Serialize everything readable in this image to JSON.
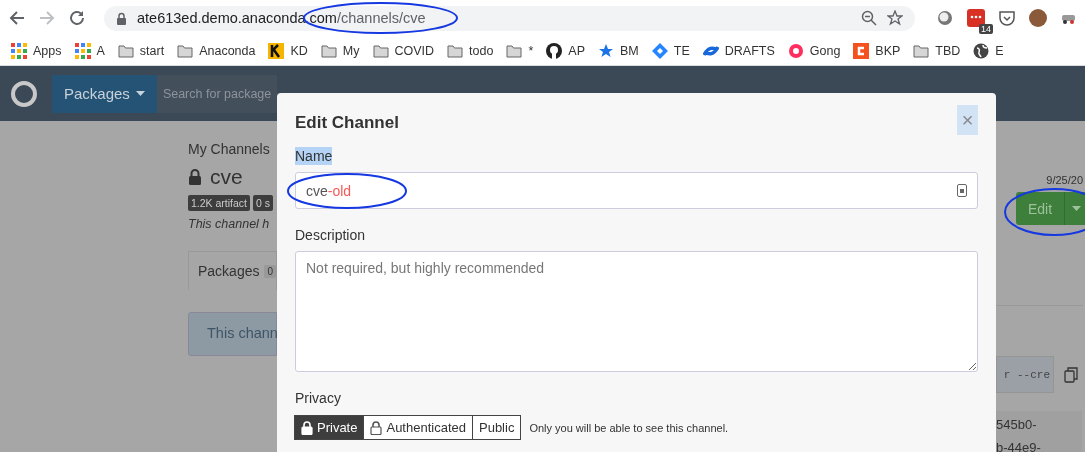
{
  "browser": {
    "forward_disabled": true,
    "url_host": "ate613ed.demo.anaconda.com",
    "url_path": "/channels/cve",
    "extension_badge": "14",
    "bookmarks": [
      {
        "label": "Apps",
        "kind": "apps"
      },
      {
        "label": "A",
        "kind": "apps"
      },
      {
        "label": "start",
        "kind": "folder"
      },
      {
        "label": "Anaconda",
        "kind": "folder"
      },
      {
        "label": "KD",
        "kind": "kd"
      },
      {
        "label": "My",
        "kind": "folder"
      },
      {
        "label": "COVID",
        "kind": "folder"
      },
      {
        "label": "todo",
        "kind": "folder"
      },
      {
        "label": "*",
        "kind": "folder"
      },
      {
        "label": "AP",
        "kind": "github"
      },
      {
        "label": "BM",
        "kind": "star"
      },
      {
        "label": "TE",
        "kind": "diamond"
      },
      {
        "label": "DRAFTS",
        "kind": "cross"
      },
      {
        "label": "Gong",
        "kind": "gong"
      },
      {
        "label": "BKP",
        "kind": "bkp"
      },
      {
        "label": "TBD",
        "kind": "folder"
      },
      {
        "label": "E",
        "kind": "globe"
      }
    ]
  },
  "navbar": {
    "menu": "Packages",
    "search_placeholder": "Search for package"
  },
  "channel_page": {
    "breadcrumb": "My Channels",
    "title": "cve",
    "private": true,
    "badges": [
      "1.2K artifact",
      "0 s"
    ],
    "description": "This channel h",
    "tab": {
      "label": "Packages",
      "count": "0"
    },
    "alert": "This chann",
    "date": "9/25/20",
    "edit_button": "Edit",
    "edit_circled": true,
    "command": "r --cre",
    "id_lines": [
      "545b0-",
      "b-44e9-"
    ]
  },
  "modal": {
    "title": "Edit Channel",
    "close": "×",
    "close_highlighted": true,
    "name_label": "Name",
    "name_label_highlighted": true,
    "name_value": [
      {
        "text": "cve",
        "kind": "base"
      },
      {
        "text": "-old",
        "kind": "added"
      }
    ],
    "description_label": "Description",
    "description_placeholder": "Not required, but highly recommended",
    "privacy_label": "Privacy",
    "privacy_options": [
      {
        "label": "Private",
        "selected": true
      },
      {
        "label": "Authenticated",
        "selected": false
      },
      {
        "label": "Public",
        "selected": false
      }
    ],
    "privacy_help": "Only you will be able to see this channel.",
    "name_circled": true
  },
  "annotations": {
    "url_circled": true
  }
}
